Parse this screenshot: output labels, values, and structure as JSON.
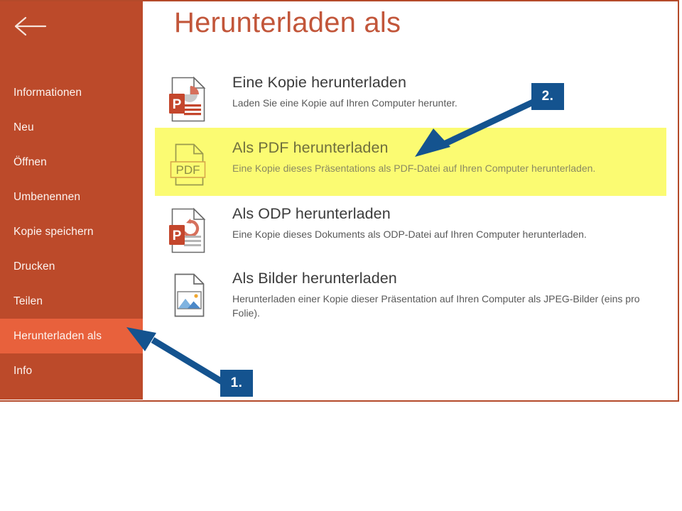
{
  "app": {
    "screen_title": "Herunterladen als",
    "back_icon": "back-arrow-icon"
  },
  "sidebar": {
    "background_color": "#bc4a2a",
    "selected_color": "#e8613c",
    "items": [
      {
        "label": "Informationen",
        "selected": false
      },
      {
        "label": "Neu",
        "selected": false
      },
      {
        "label": "Öffnen",
        "selected": false
      },
      {
        "label": "Umbenennen",
        "selected": false
      },
      {
        "label": "Kopie speichern",
        "selected": false
      },
      {
        "label": "Drucken",
        "selected": false
      },
      {
        "label": "Teilen",
        "selected": false
      },
      {
        "label": "Herunterladen als",
        "selected": true
      },
      {
        "label": "Info",
        "selected": false
      }
    ]
  },
  "main": {
    "title": "Herunterladen als",
    "title_color": "#c2563a",
    "highlight_color": "#fbfb72",
    "options": [
      {
        "icon": "powerpoint-file-icon",
        "title": "Eine Kopie herunterladen",
        "desc": "Laden Sie eine Kopie auf Ihren Computer herunter.",
        "highlighted": false
      },
      {
        "icon": "pdf-file-icon",
        "title": "Als PDF herunterladen",
        "desc": "Eine Kopie dieses Präsentations als PDF-Datei auf Ihren Computer herunterladen.",
        "highlighted": true
      },
      {
        "icon": "odp-file-icon",
        "title": "Als ODP herunterladen",
        "desc": "Eine Kopie dieses Dokuments als ODP-Datei auf Ihren Computer herunterladen.",
        "highlighted": false
      },
      {
        "icon": "image-file-icon",
        "title": "Als Bilder herunterladen",
        "desc": "Herunterladen einer Kopie dieser Präsentation auf Ihren Computer als JPEG-Bilder (eins pro Folie).",
        "highlighted": false
      }
    ]
  },
  "annotations": {
    "color": "#14538f",
    "steps": [
      {
        "label": "1.",
        "points_to": "Herunterladen als"
      },
      {
        "label": "2.",
        "points_to": "Als PDF herunterladen"
      }
    ]
  }
}
